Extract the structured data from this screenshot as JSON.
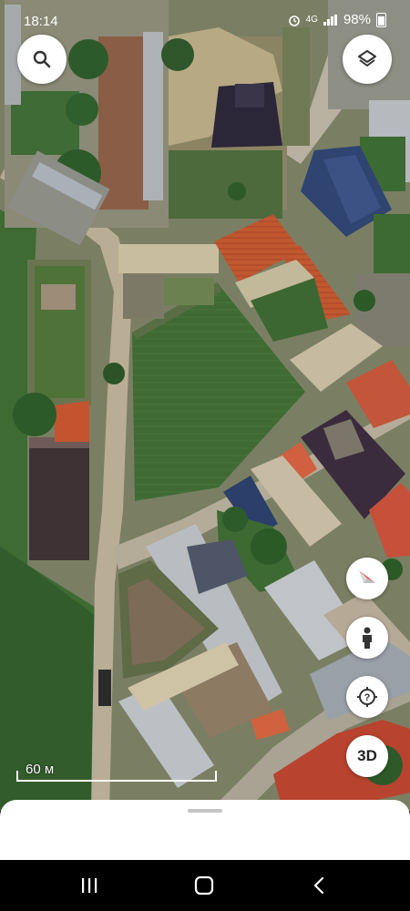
{
  "status_bar": {
    "time": "18:14",
    "network": "4G",
    "battery": "98%"
  },
  "map": {
    "type": "satellite",
    "scale_label": "60 м"
  },
  "controls": {
    "search_icon": "search-icon",
    "layers_icon": "layers-icon",
    "compass_icon": "compass-icon",
    "street_view_icon": "pegman-icon",
    "my_location_icon": "location-target-icon",
    "view_3d_label": "3D"
  },
  "colors": {
    "grass": "#3f6a30",
    "roof_red": "#c2552e",
    "roof_blue": "#2e4470",
    "roof_dark": "#3a2f3d",
    "roof_gray": "#b9bcc0",
    "road": "#b7ae9c"
  }
}
